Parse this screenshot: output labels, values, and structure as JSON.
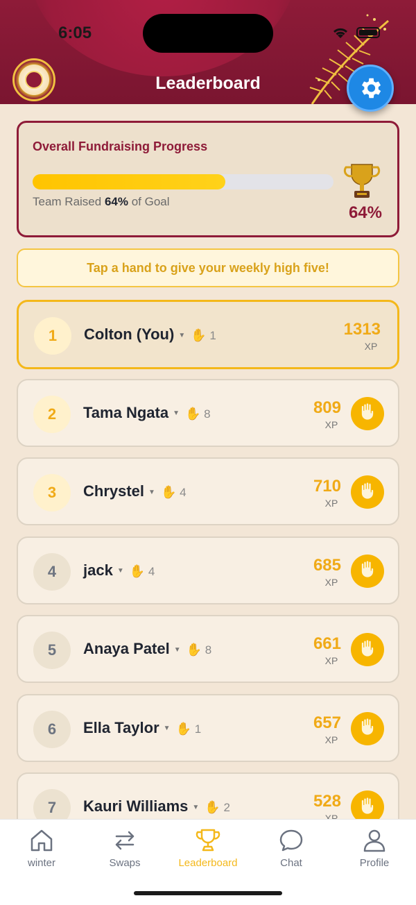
{
  "status": {
    "time": "6:05"
  },
  "header": {
    "title": "Leaderboard"
  },
  "progress": {
    "title": "Overall Fundraising Progress",
    "fill_fraction": 0.64,
    "sub_prefix": "Team Raised ",
    "sub_value": "64%",
    "sub_suffix": " of Goal",
    "percent": "64%"
  },
  "tip": "Tap a hand to give your weekly high five!",
  "xp_label": "XP",
  "leaderboard": [
    {
      "rank": "1",
      "name": "Colton (You)",
      "high_fives": "1",
      "xp": "1313",
      "you": true
    },
    {
      "rank": "2",
      "name": "Tama Ngata",
      "high_fives": "8",
      "xp": "809"
    },
    {
      "rank": "3",
      "name": "Chrystel",
      "high_fives": "4",
      "xp": "710"
    },
    {
      "rank": "4",
      "name": "jack",
      "high_fives": "4",
      "xp": "685"
    },
    {
      "rank": "5",
      "name": "Anaya Patel",
      "high_fives": "8",
      "xp": "661"
    },
    {
      "rank": "6",
      "name": "Ella Taylor",
      "high_fives": "1",
      "xp": "657"
    },
    {
      "rank": "7",
      "name": "Kauri Williams",
      "high_fives": "2",
      "xp": "528"
    }
  ],
  "tabs": [
    {
      "label": "winter",
      "icon": "home-icon"
    },
    {
      "label": "Swaps",
      "icon": "swap-icon"
    },
    {
      "label": "Leaderboard",
      "icon": "trophy-icon",
      "active": true
    },
    {
      "label": "Chat",
      "icon": "chat-icon"
    },
    {
      "label": "Profile",
      "icon": "profile-icon"
    }
  ],
  "colors": {
    "brand": "#8e1b38",
    "accent": "#f4b81a",
    "settings": "#1e88e5"
  }
}
